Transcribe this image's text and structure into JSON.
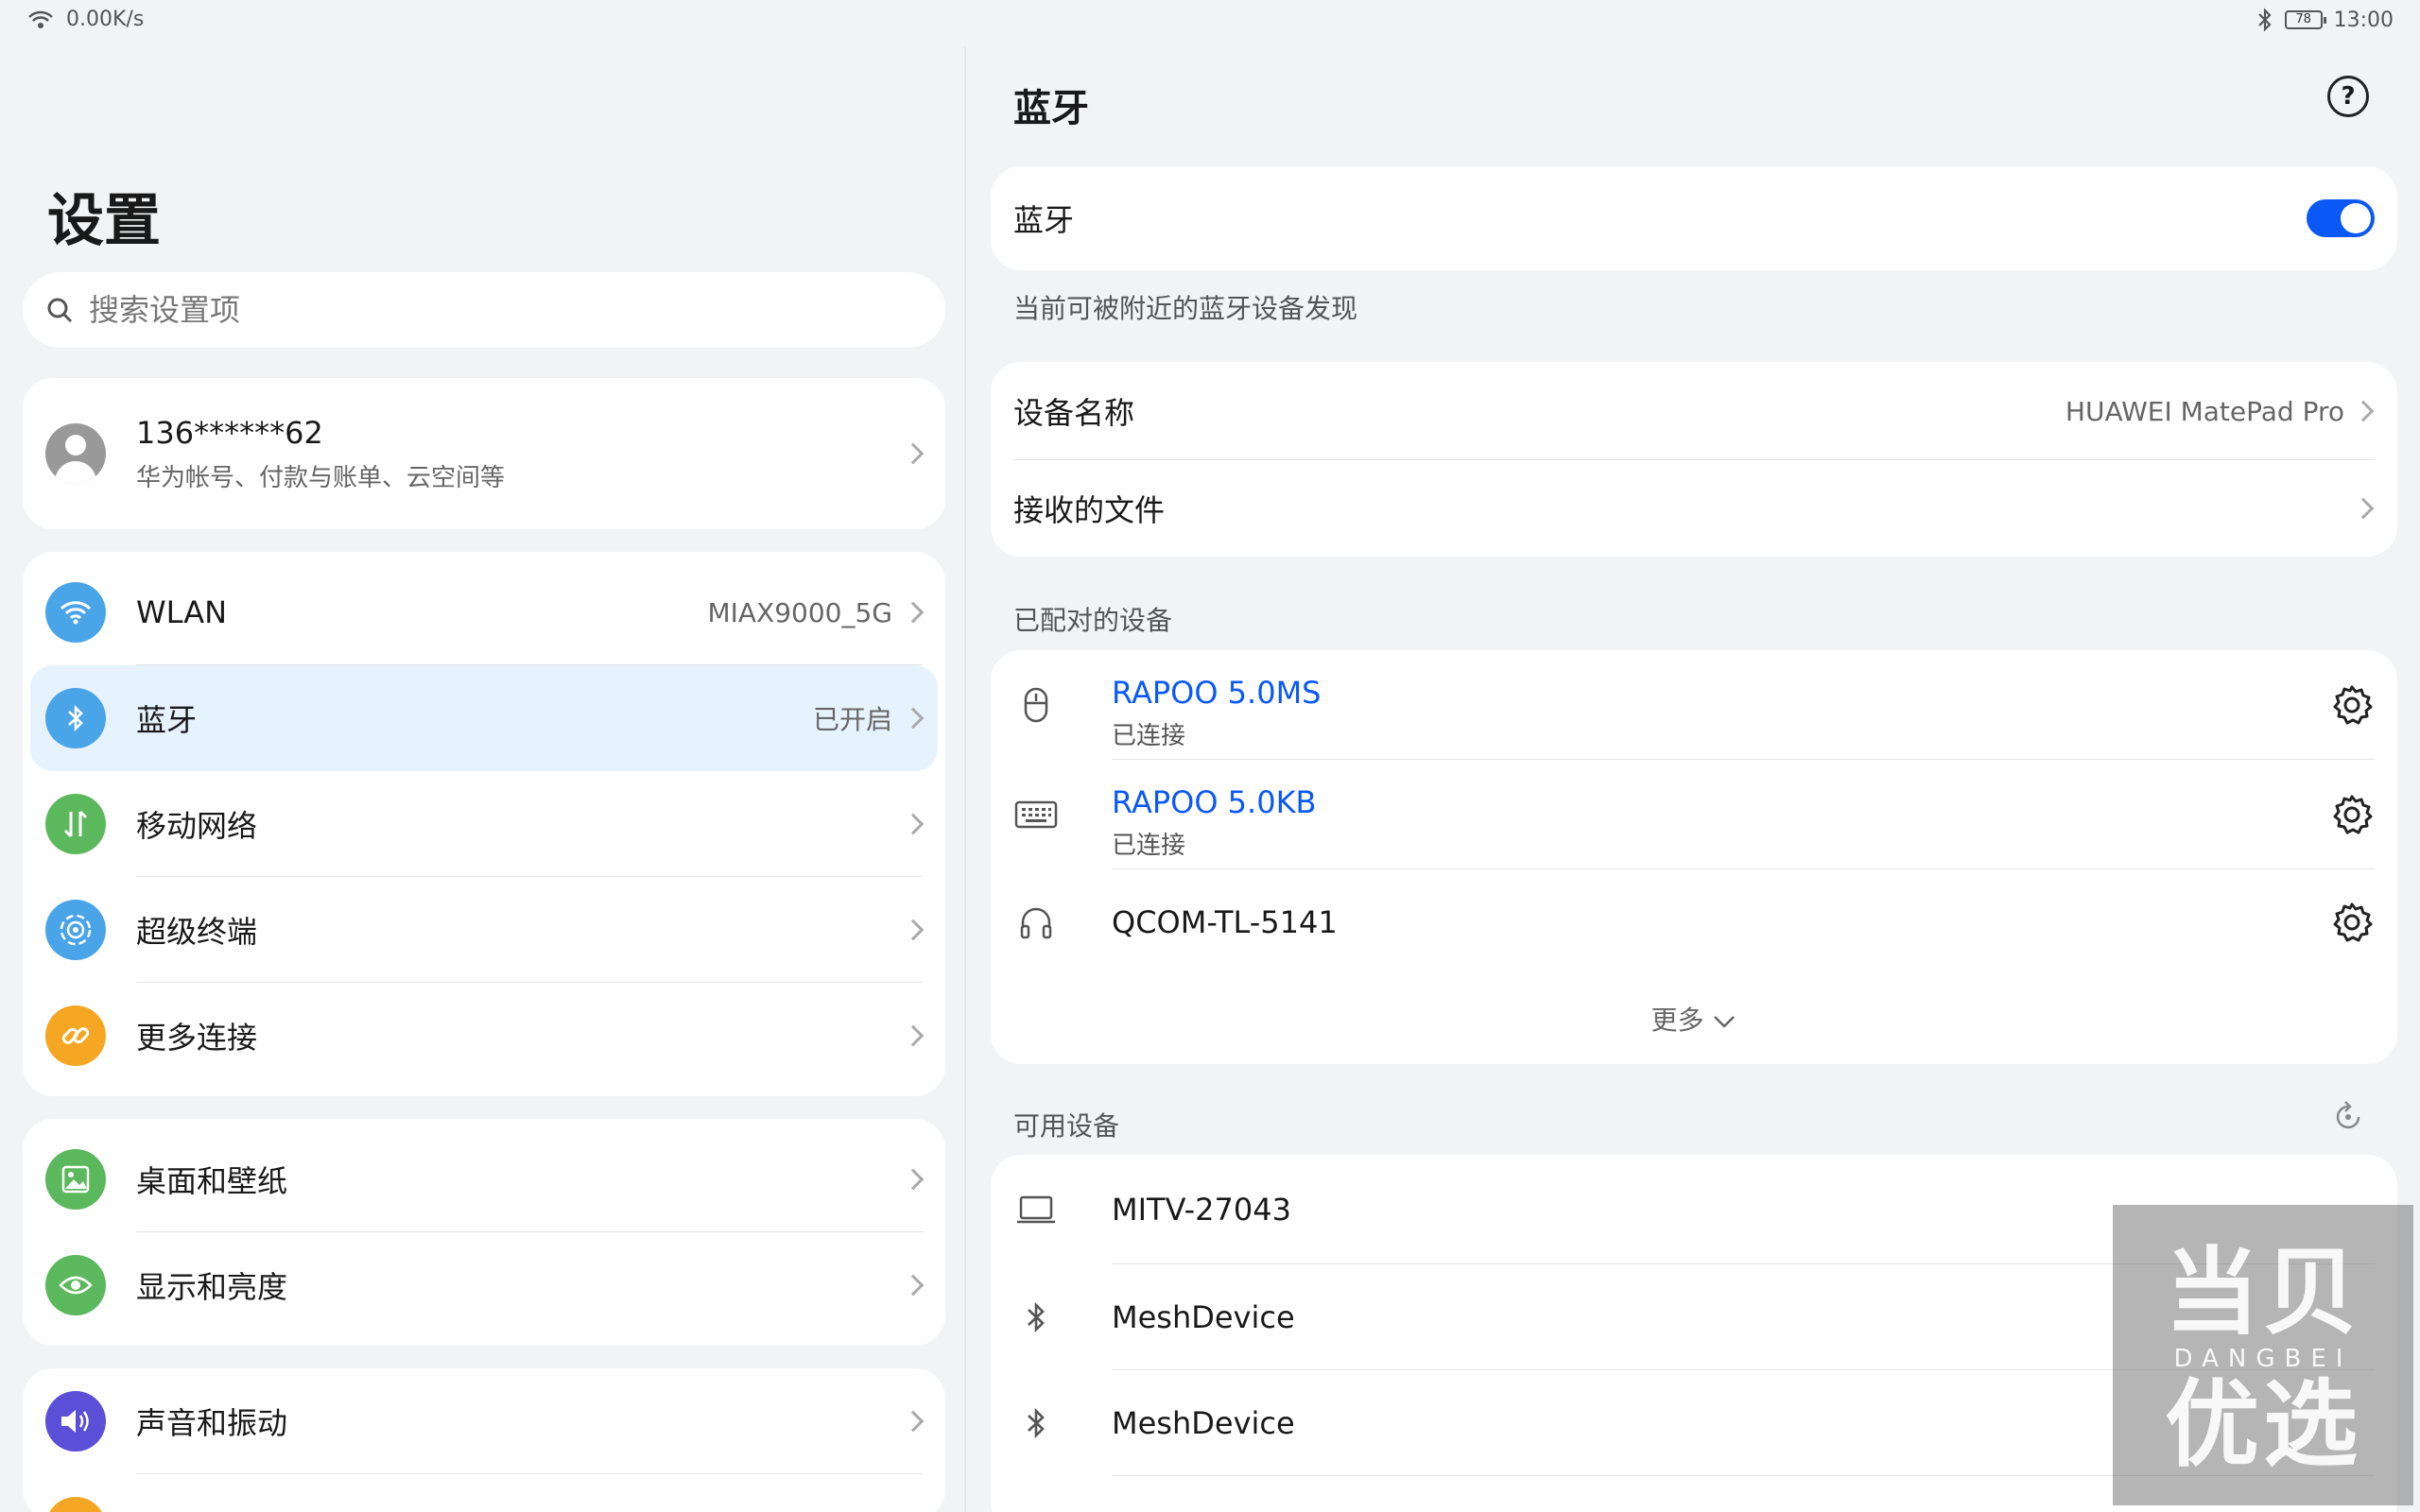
{
  "status_bar": {
    "speed": "0.00K/s",
    "battery": "78",
    "time": "13:00"
  },
  "left": {
    "title": "设置",
    "search_placeholder": "搜索设置项",
    "account": {
      "name": "136******62",
      "subtitle": "华为帐号、付款与账单、云空间等"
    },
    "groups": [
      [
        {
          "label": "WLAN",
          "value": "MIAX9000_5G",
          "icon": "wifi-icon",
          "color": "#4aa4e8"
        },
        {
          "label": "蓝牙",
          "value": "已开启",
          "icon": "bluetooth-icon",
          "color": "#4aa4e8",
          "active": true
        },
        {
          "label": "移动网络",
          "value": "",
          "icon": "mobile-network-icon",
          "color": "#5cb85c"
        },
        {
          "label": "超级终端",
          "value": "",
          "icon": "super-device-icon",
          "color": "#4aa4e8"
        },
        {
          "label": "更多连接",
          "value": "",
          "icon": "link-icon",
          "color": "#f5a623"
        }
      ],
      [
        {
          "label": "桌面和壁纸",
          "value": "",
          "icon": "wallpaper-icon",
          "color": "#5cb85c"
        },
        {
          "label": "显示和亮度",
          "value": "",
          "icon": "display-icon",
          "color": "#5cb85c"
        }
      ],
      [
        {
          "label": "声音和振动",
          "value": "",
          "icon": "sound-icon",
          "color": "#5a4fd6"
        }
      ]
    ]
  },
  "right": {
    "title": "蓝牙",
    "bt_toggle_label": "蓝牙",
    "bt_on": true,
    "discoverable_text": "当前可被附近的蓝牙设备发现",
    "device_name_label": "设备名称",
    "device_name_value": "HUAWEI MatePad Pro",
    "received_files_label": "接收的文件",
    "paired_header": "已配对的设备",
    "paired": [
      {
        "name": "RAPOO 5.0MS",
        "status": "已连接",
        "icon": "mouse-icon"
      },
      {
        "name": "RAPOO 5.0KB",
        "status": "已连接",
        "icon": "keyboard-icon"
      },
      {
        "name": "QCOM-TL-5141",
        "status": "",
        "icon": "headphones-icon"
      }
    ],
    "more_label": "更多",
    "available_header": "可用设备",
    "available": [
      {
        "name": "MITV-27043",
        "icon": "laptop-icon"
      },
      {
        "name": "MeshDevice",
        "icon": "bluetooth-icon"
      },
      {
        "name": "MeshDevice",
        "icon": "bluetooth-icon"
      }
    ]
  },
  "watermark": {
    "cn": "当贝优选",
    "en": "DANGBEI"
  },
  "colors": {
    "accent": "#0a59f7",
    "active_row": "#e6f2fd"
  }
}
